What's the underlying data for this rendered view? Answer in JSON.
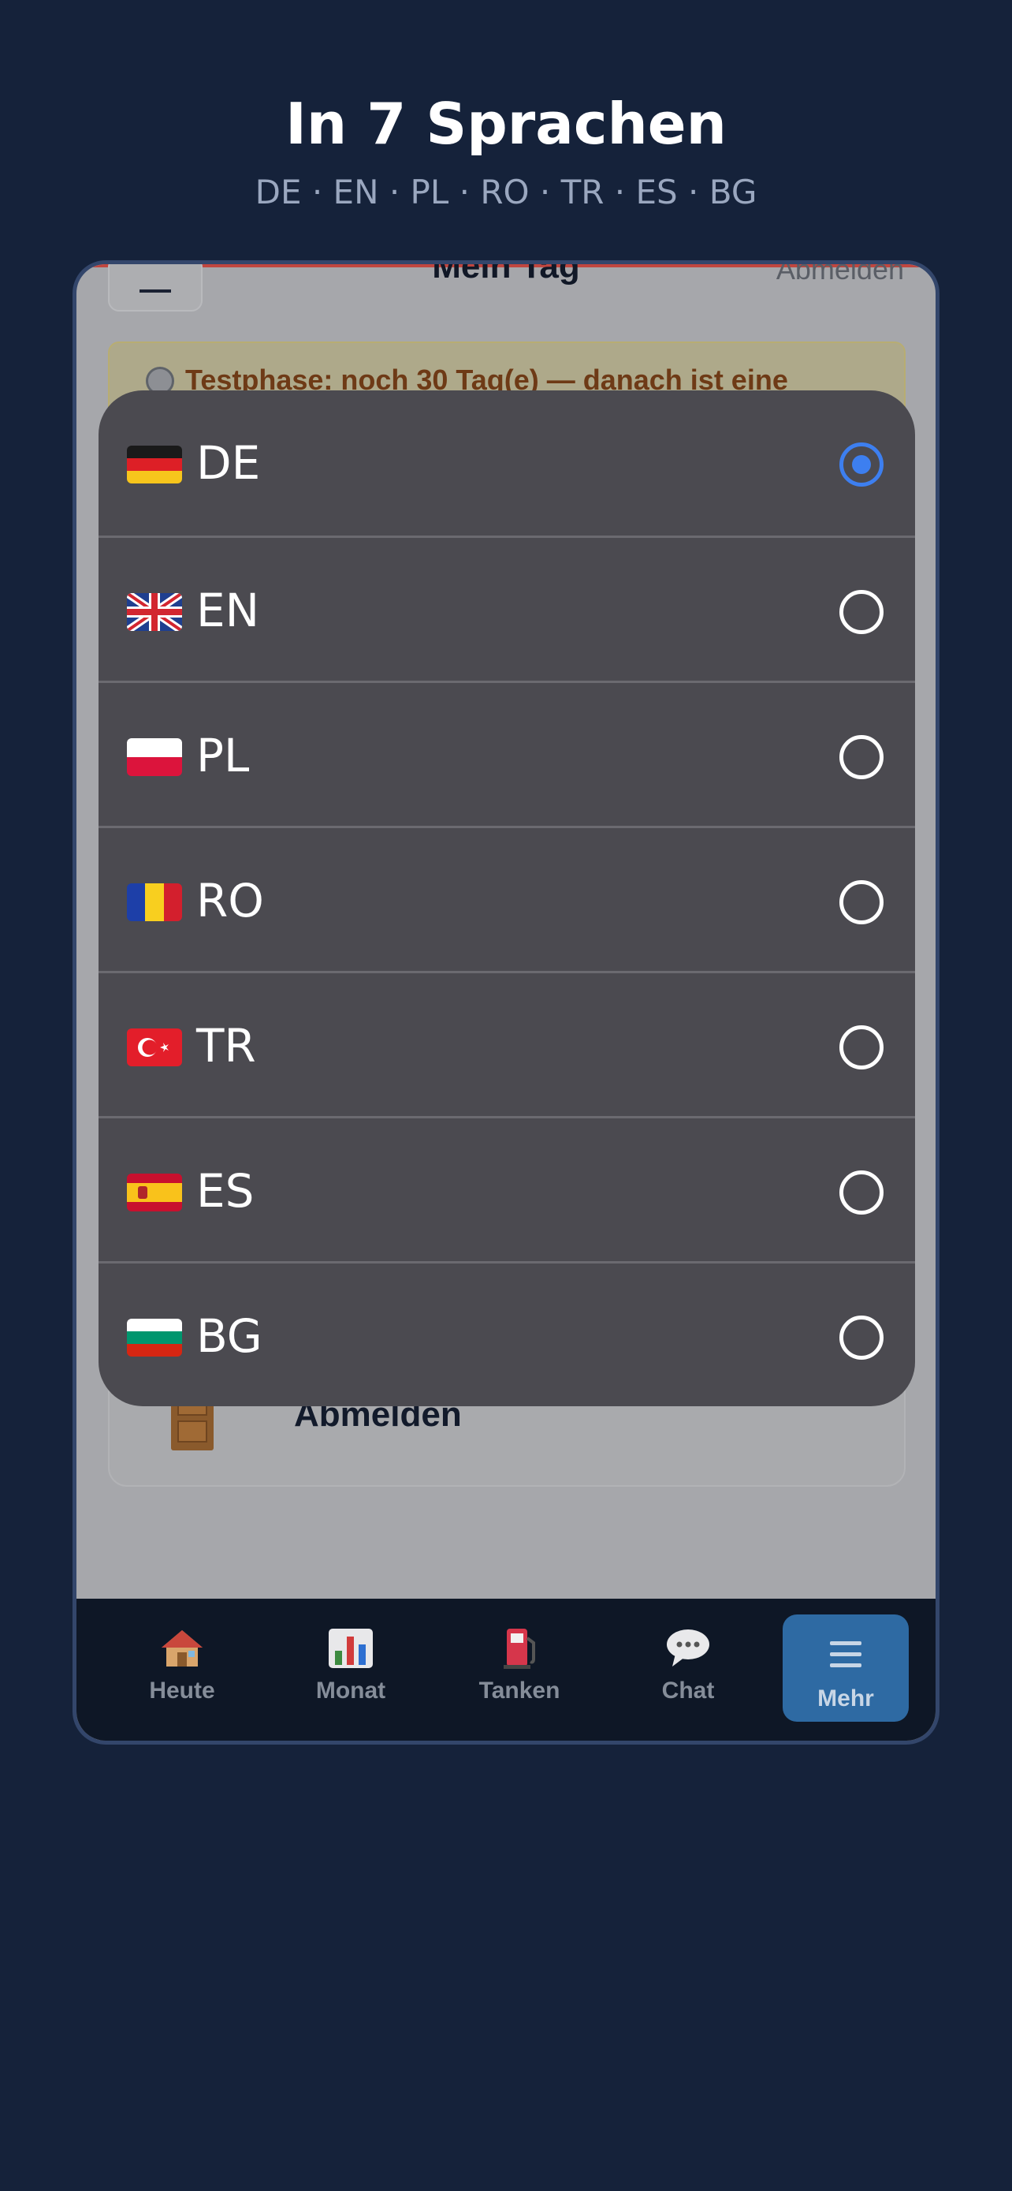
{
  "promo": {
    "title": "In 7 Sprachen",
    "subtitle": "DE · EN · PL · RO · TR · ES · BG"
  },
  "header": {
    "title": "Mein Tag",
    "logout": "Abmelden"
  },
  "trial_banner": {
    "text": "Testphase: noch 30 Tag(e) — danach ist eine"
  },
  "card": {
    "label": "Abmelden"
  },
  "languages": {
    "selected": "DE",
    "options": [
      {
        "code": "DE",
        "flag": "de-flag-icon"
      },
      {
        "code": "EN",
        "flag": "gb-flag-icon"
      },
      {
        "code": "PL",
        "flag": "pl-flag-icon"
      },
      {
        "code": "RO",
        "flag": "ro-flag-icon"
      },
      {
        "code": "TR",
        "flag": "tr-flag-icon"
      },
      {
        "code": "ES",
        "flag": "es-flag-icon"
      },
      {
        "code": "BG",
        "flag": "bg-flag-icon"
      }
    ]
  },
  "tabs": [
    {
      "label": "Heute",
      "icon": "house-icon"
    },
    {
      "label": "Monat",
      "icon": "bar-chart-icon"
    },
    {
      "label": "Tanken",
      "icon": "fuel-pump-icon"
    },
    {
      "label": "Chat",
      "icon": "speech-bubble-icon"
    },
    {
      "label": "Mehr",
      "icon": "menu-icon",
      "active": true
    }
  ],
  "colors": {
    "background": "#15223a",
    "sheet": "#4b4a50",
    "radio_selected": "#3d7ff0",
    "tab_active": "#2e6aa3"
  }
}
